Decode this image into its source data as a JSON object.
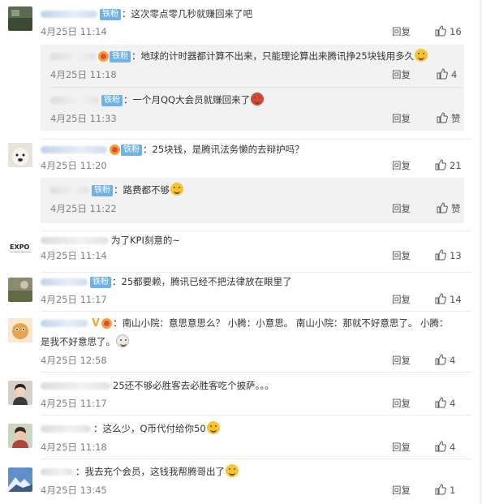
{
  "comments": [
    {
      "user_hidden": true,
      "badge": "铁粉",
      "text": "这次零点零几秒就赚回来了吧",
      "time": "4月25日 11:14",
      "reply": "回复",
      "likes": "16",
      "avatar": "dark-scenery",
      "replies": [
        {
          "badge": "铁粉",
          "text": "地球的计时器都计算不出来，只能理论算出来腾讯挣25块钱用多久",
          "emoji": "laugh-cry-emoji",
          "time": "4月25日 11:18",
          "reply": "回复",
          "likes": "4"
        },
        {
          "badge": "铁粉",
          "text": "一个月QQ大会员就赚回来了",
          "emoji": "devil-emoji",
          "time": "4月25日 11:33",
          "reply": "回复",
          "likes": "赞"
        }
      ]
    },
    {
      "badge": "铁粉",
      "text": "25块钱，是腾讯法务懒的去辩护吗？",
      "time": "4月25日 11:20",
      "reply": "回复",
      "likes": "21",
      "avatar": "white-dog",
      "replies": [
        {
          "badge": "铁粉",
          "text": "路费都不够",
          "emoji": "smile-emoji",
          "time": "4月25日 11:22",
          "reply": "回复",
          "likes": "赞"
        }
      ]
    },
    {
      "text": "为了KPI刻意的~",
      "time": "4月25日 11:14",
      "reply": "回复",
      "likes": "13",
      "avatar": "expo-logo",
      "avatar_text": "EXPO"
    },
    {
      "badge": "铁粉",
      "text": "25都要赖，腾讯已经不把法律放在眼里了",
      "time": "4月25日 11:17",
      "reply": "回复",
      "likes": "14",
      "avatar": "landscape"
    },
    {
      "badge": "V",
      "text": "南山小院：意思意思么？ 小腾：小意思。 南山小院：那就不好意思了。 小腾：是我不好意思了。",
      "emoji": "scared-emoji",
      "time": "4月25日 12:58",
      "reply": "回复",
      "likes": "4",
      "avatar": "cartoon-cat"
    },
    {
      "text": "25还不够必胜客去必胜客吃个披萨。。。",
      "time": "4月25日 11:17",
      "reply": "回复",
      "likes": "4",
      "avatar": "portrait-woman"
    },
    {
      "text": "这么少，Q币代付给你50",
      "emoji": "grin-emoji",
      "time": "4月25日 11:18",
      "reply": "回复",
      "likes": "4",
      "avatar": "portrait-child"
    },
    {
      "text": "我去充个会员，这钱我帮腾哥出了",
      "emoji": "tongue-emoji",
      "time": "4月25日 13:45",
      "reply": "回复",
      "likes": "1",
      "avatar": "mountain"
    }
  ],
  "icons": {
    "like": "thumb-up-icon"
  },
  "colors": {
    "badge": "#6fb2ea",
    "meta": "#808080",
    "subbox": "#f2f2f2"
  }
}
